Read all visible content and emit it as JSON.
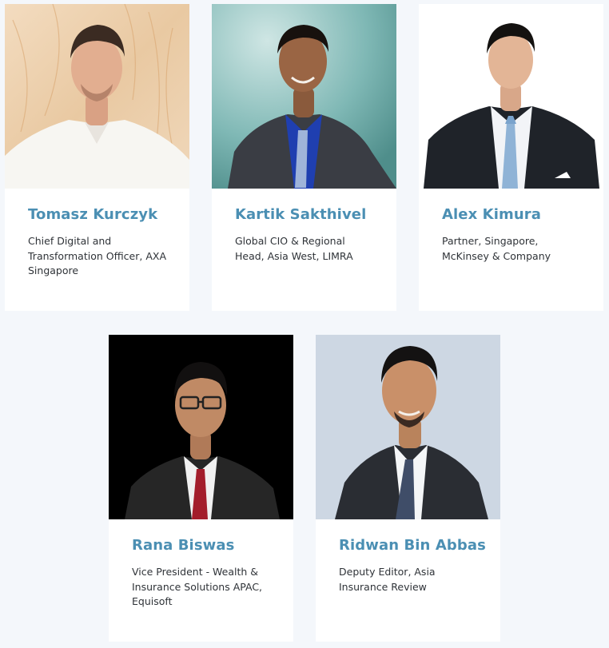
{
  "speakers": [
    {
      "name": "Tomasz Kurczyk",
      "title": "Chief Digital and Transformation Officer, AXA Singapore",
      "photo": "portrait-man-white-shirt"
    },
    {
      "name": "Kartik Sakthivel",
      "title": "Global CIO & Regional Head, Asia West, LIMRA",
      "photo": "portrait-man-dark-suit-blue-shirt"
    },
    {
      "name": "Alex Kimura",
      "title": "Partner, Singapore, McKinsey & Company",
      "photo": "portrait-man-dark-suit-white-background"
    },
    {
      "name": "Rana Biswas",
      "title": "Vice President - Wealth & Insurance Solutions APAC, Equisoft",
      "photo": "portrait-man-glasses-black-background"
    },
    {
      "name": "Ridwan Bin Abbas",
      "title": "Deputy Editor, Asia Insurance Review",
      "photo": "portrait-man-suit-grey-background"
    }
  ],
  "colors": {
    "page_background": "#f4f7fb",
    "card_background": "#ffffff",
    "name_accent": "#4b8fb3",
    "title_text": "#2f3338"
  }
}
